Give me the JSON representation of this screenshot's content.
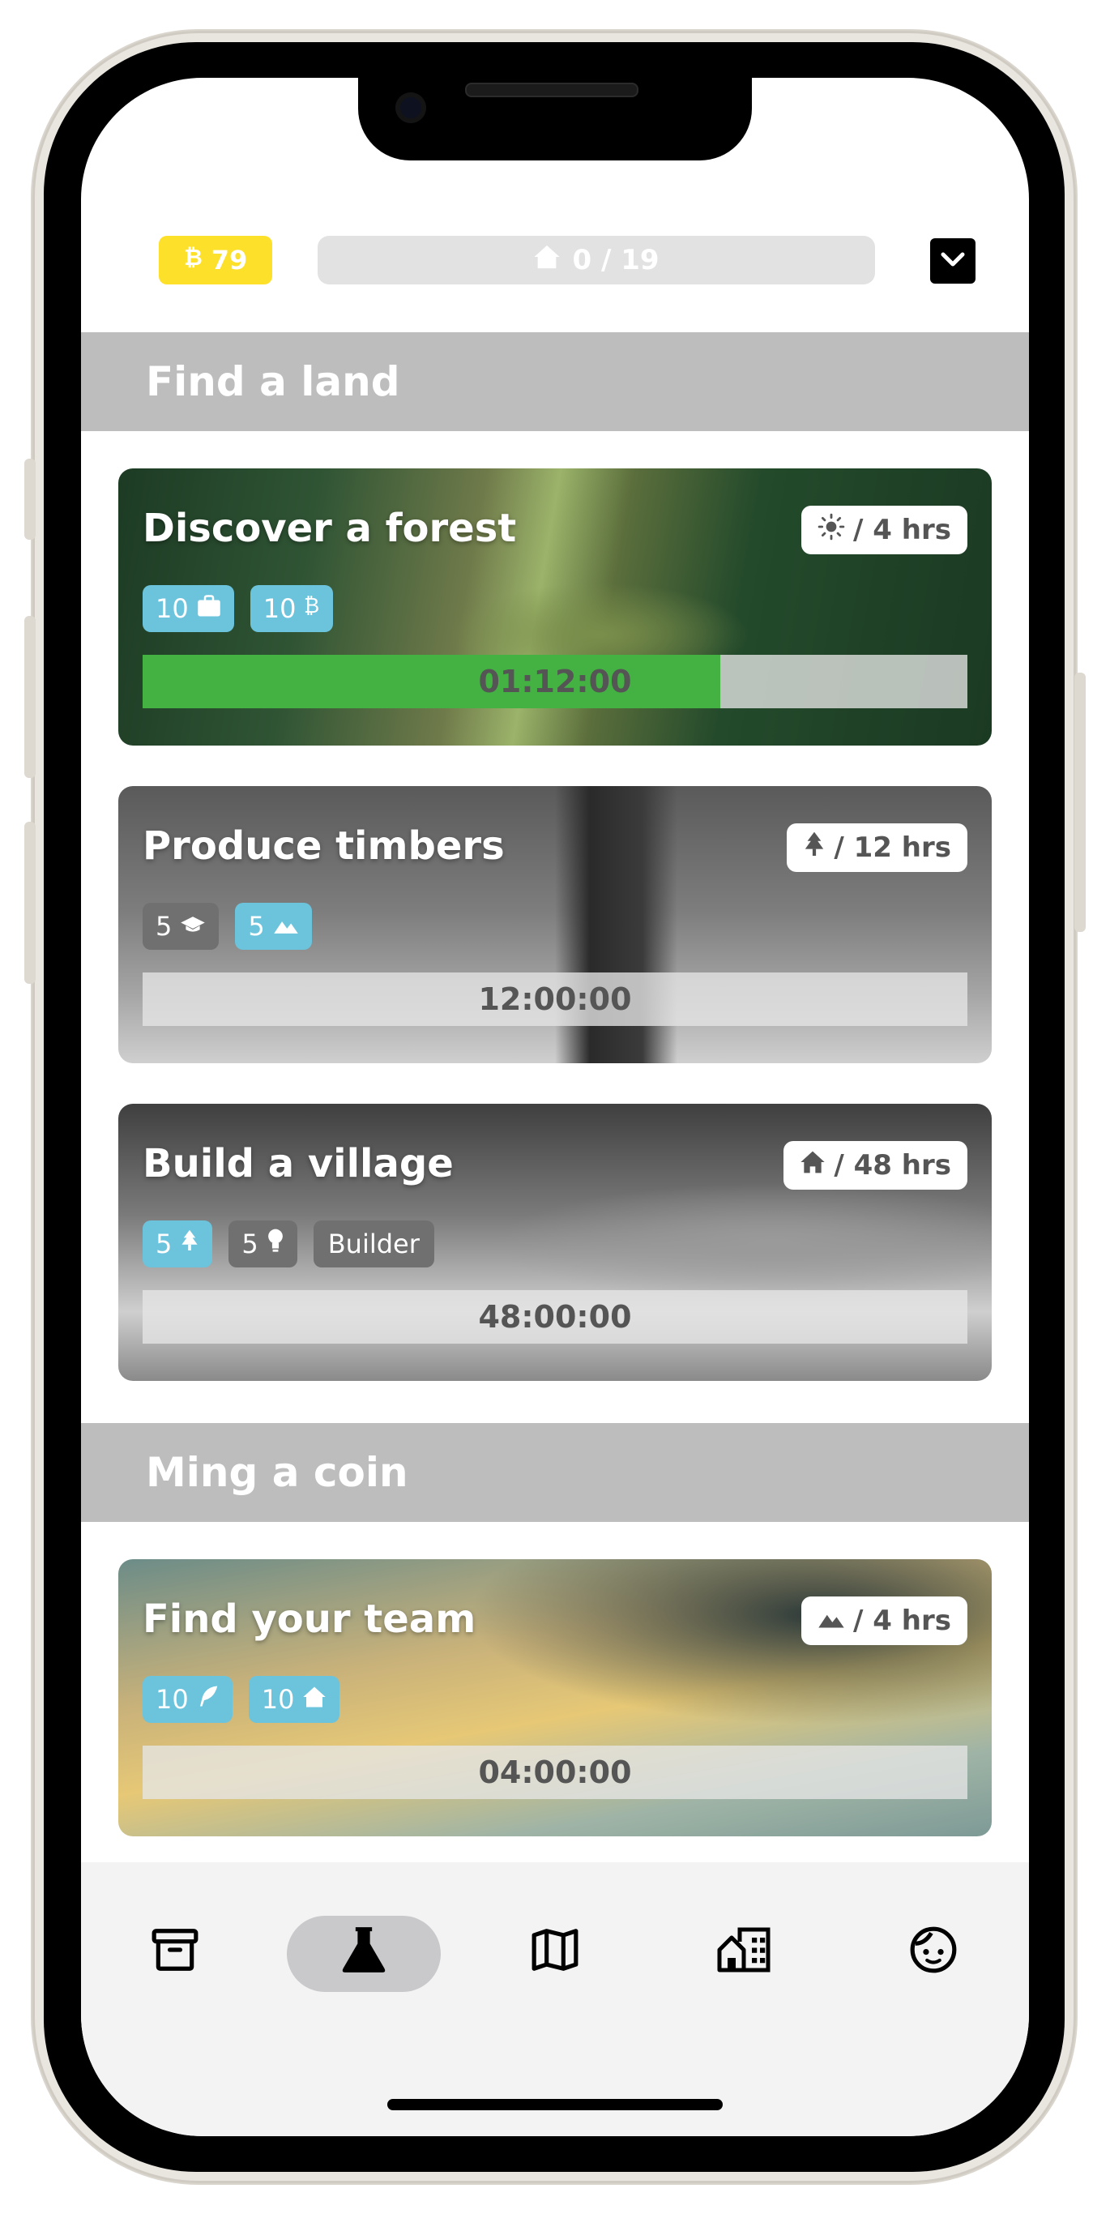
{
  "header": {
    "coins": "79",
    "coin_icon": "bitcoin-icon",
    "houses": "0 / 19",
    "house_icon": "house-icon",
    "menu_icon": "chevron-down-icon"
  },
  "sections": [
    {
      "title": "Find a land",
      "tasks": [
        {
          "title": "Discover a forest",
          "rate": "/ 4 hrs",
          "rate_icon": "sun-icon",
          "requirements": [
            {
              "value": "10",
              "icon": "briefcase-icon",
              "color": "#6cc3dc"
            },
            {
              "value": "10",
              "icon": "bitcoin-icon",
              "color": "#6cc3dc"
            }
          ],
          "timer": "01:12:00",
          "progress": 0.7
        },
        {
          "title": "Produce timbers",
          "rate": "/ 12 hrs",
          "rate_icon": "tree-icon",
          "requirements": [
            {
              "value": "5",
              "icon": "graduation-cap-icon",
              "color": "#707070"
            },
            {
              "value": "5",
              "icon": "mountain-icon",
              "color": "#6cc3dc"
            }
          ],
          "timer": "12:00:00",
          "progress": 0
        },
        {
          "title": "Build a village",
          "rate": "/ 48 hrs",
          "rate_icon": "house-icon",
          "requirements": [
            {
              "value": "5",
              "icon": "tree-icon",
              "color": "#6cc3dc"
            },
            {
              "value": "5",
              "icon": "lightbulb-icon",
              "color": "#707070"
            }
          ],
          "extra_chip": "Builder",
          "timer": "48:00:00",
          "progress": 0
        }
      ]
    },
    {
      "title": "Ming a coin",
      "tasks": [
        {
          "title": "Find your team",
          "rate": "/ 4 hrs",
          "rate_icon": "mountain-icon",
          "requirements": [
            {
              "value": "10",
              "icon": "feather-icon",
              "color": "#6cc3dc"
            },
            {
              "value": "10",
              "icon": "house-icon",
              "color": "#6cc3dc"
            }
          ],
          "timer": "04:00:00",
          "progress": 0
        }
      ]
    }
  ],
  "nav": {
    "items": [
      "archive-icon",
      "flask-icon",
      "map-icon",
      "buildings-icon",
      "face-icon"
    ],
    "active_index": 1
  },
  "colors": {
    "coin": "#fde02a",
    "chip_blue": "#6cc3dc",
    "chip_gray": "#707070",
    "progress_fill": "#43b243",
    "section_header": "#bdbdbd"
  }
}
